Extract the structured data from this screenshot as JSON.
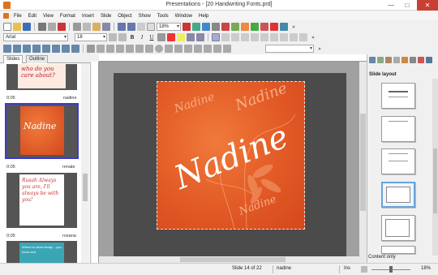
{
  "window": {
    "title": "Presentations - [20 Handwriting Fonts.prd]",
    "min": "—",
    "max": "□",
    "close": "✕"
  },
  "menu": [
    "File",
    "Edit",
    "View",
    "Format",
    "Insert",
    "Slide",
    "Object",
    "Show",
    "Tools",
    "Window",
    "Help"
  ],
  "toolbar": {
    "zoom": "18%"
  },
  "format": {
    "font": "Arial",
    "size": "18",
    "bold": "B",
    "italic": "I",
    "underline": "U",
    "more": "»"
  },
  "tabs": {
    "slides": "Slides",
    "outline": "Outline"
  },
  "slides": [
    {
      "text": "who do you care about?",
      "time": "0:05",
      "name": "nadine"
    },
    {
      "text": "Nadine",
      "time": "0:05",
      "name": "renate"
    },
    {
      "text": "Rusah Always you are, I'll always be with you!",
      "time": "0:05",
      "name": "roxana"
    },
    {
      "text": "Where to when today ...you know and",
      "time": "",
      "name": ""
    }
  ],
  "slide_text": "Nadine",
  "right_pane": {
    "title": "Slide layout",
    "content_only": "Content only",
    "zoom": "18%"
  },
  "status": {
    "slide": "Slide 14 of 22",
    "name": "nadine",
    "mode": "Ins"
  }
}
